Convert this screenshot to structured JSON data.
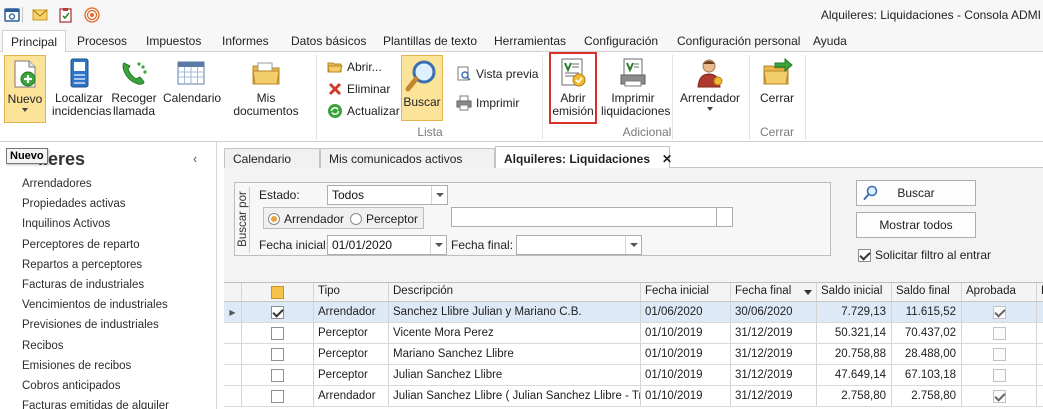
{
  "window": {
    "title": "Alquileres: Liquidaciones - Consola ADMI"
  },
  "ribbon_tabs": [
    "Principal",
    "Procesos",
    "Impuestos",
    "Informes",
    "Datos básicos",
    "Plantillas de texto",
    "Herramientas",
    "Configuración",
    "Configuración personal",
    "Ayuda"
  ],
  "ribbon": {
    "nuevo": "Nuevo",
    "localizar": [
      "Localizar",
      "incidencias"
    ],
    "recoger": [
      "Recoger",
      "llamada"
    ],
    "calendario": "Calendario",
    "mis_documentos": "Mis documentos",
    "abrir": "Abrir...",
    "eliminar": "Eliminar",
    "actualizar": "Actualizar",
    "buscar": "Buscar",
    "vista_previa": "Vista previa",
    "imprimir": "Imprimir",
    "abrir_emision": [
      "Abrir",
      "emisión"
    ],
    "imprimir_liquidaciones": [
      "Imprimir",
      "liquidaciones"
    ],
    "arrendador": "Arrendador",
    "cerrar": "Cerrar",
    "group_lista": "Lista",
    "group_adicional": "Adicional",
    "group_cerrar": "Cerrar"
  },
  "left_panel": {
    "tooltip": "Nuevo",
    "title_visible": "lleres",
    "items": [
      "Arrendadores",
      "Propiedades activas",
      "Inquilinos Activos",
      "Perceptores de reparto",
      "Repartos a perceptores",
      "Facturas de industriales",
      "Vencimientos de industriales",
      "Previsiones de industriales",
      "Recibos",
      "Emisiones de recibos",
      "Cobros anticipados",
      "Facturas emitidas de alquiler"
    ]
  },
  "doc_tabs": [
    "Calendario",
    "Mis comunicados activos",
    "Alquileres: Liquidaciones"
  ],
  "filter": {
    "group_label": "Buscar por",
    "estado_label": "Estado:",
    "estado_value": "Todos",
    "radio_arrendador": "Arrendador",
    "radio_perceptor": "Perceptor",
    "selected_radio": "Arrendador",
    "fecha_inicial_label": "Fecha inicial:",
    "fecha_inicial_value": "01/01/2020",
    "fecha_final_label": "Fecha final:",
    "fecha_final_value": "",
    "buscar_button": "Buscar",
    "mostrar_todos_button": "Mostrar todos",
    "solicitar_filtro_label": "Solicitar filtro al entrar",
    "solicitar_filtro_checked": true
  },
  "grid": {
    "columns": [
      "Tipo",
      "Descripción",
      "Fecha inicial",
      "Fecha final",
      "Saldo inicial",
      "Saldo final",
      "Aprobada",
      "D"
    ],
    "sorted_column": "Fecha final",
    "rows": [
      {
        "checked": true,
        "tipo": "Arrendador",
        "descripcion": "Sanchez Llibre Julian y Mariano C.B.",
        "fecha_inicial": "01/06/2020",
        "fecha_final": "30/06/2020",
        "saldo_inicial": "7.729,13",
        "saldo_final": "11.615,52",
        "aprobada": true,
        "selected": true
      },
      {
        "checked": false,
        "tipo": "Perceptor",
        "descripcion": "Vicente Mora Perez",
        "fecha_inicial": "01/10/2019",
        "fecha_final": "31/12/2019",
        "saldo_inicial": "50.321,14",
        "saldo_final": "70.437,02",
        "aprobada": false,
        "selected": false
      },
      {
        "checked": false,
        "tipo": "Perceptor",
        "descripcion": "Mariano Sanchez Llibre",
        "fecha_inicial": "01/10/2019",
        "fecha_final": "31/12/2019",
        "saldo_inicial": "20.758,88",
        "saldo_final": "28.488,00",
        "aprobada": false,
        "selected": false
      },
      {
        "checked": false,
        "tipo": "Perceptor",
        "descripcion": "Julian Sanchez Llibre",
        "fecha_inicial": "01/10/2019",
        "fecha_final": "31/12/2019",
        "saldo_inicial": "47.649,14",
        "saldo_final": "67.103,18",
        "aprobada": false,
        "selected": false
      },
      {
        "checked": false,
        "tipo": "Arrendador",
        "descripcion": "Julian Sanchez Llibre ( Julian Sanchez Llibre - Tra...",
        "fecha_inicial": "01/10/2019",
        "fecha_final": "31/12/2019",
        "saldo_inicial": "2.758,80",
        "saldo_final": "2.758,80",
        "aprobada": true,
        "selected": false
      }
    ]
  },
  "colors": {
    "ribbon_selected": "#fbe39a",
    "highlight_red": "#d9302c",
    "row_selected": "#dde9f7"
  }
}
